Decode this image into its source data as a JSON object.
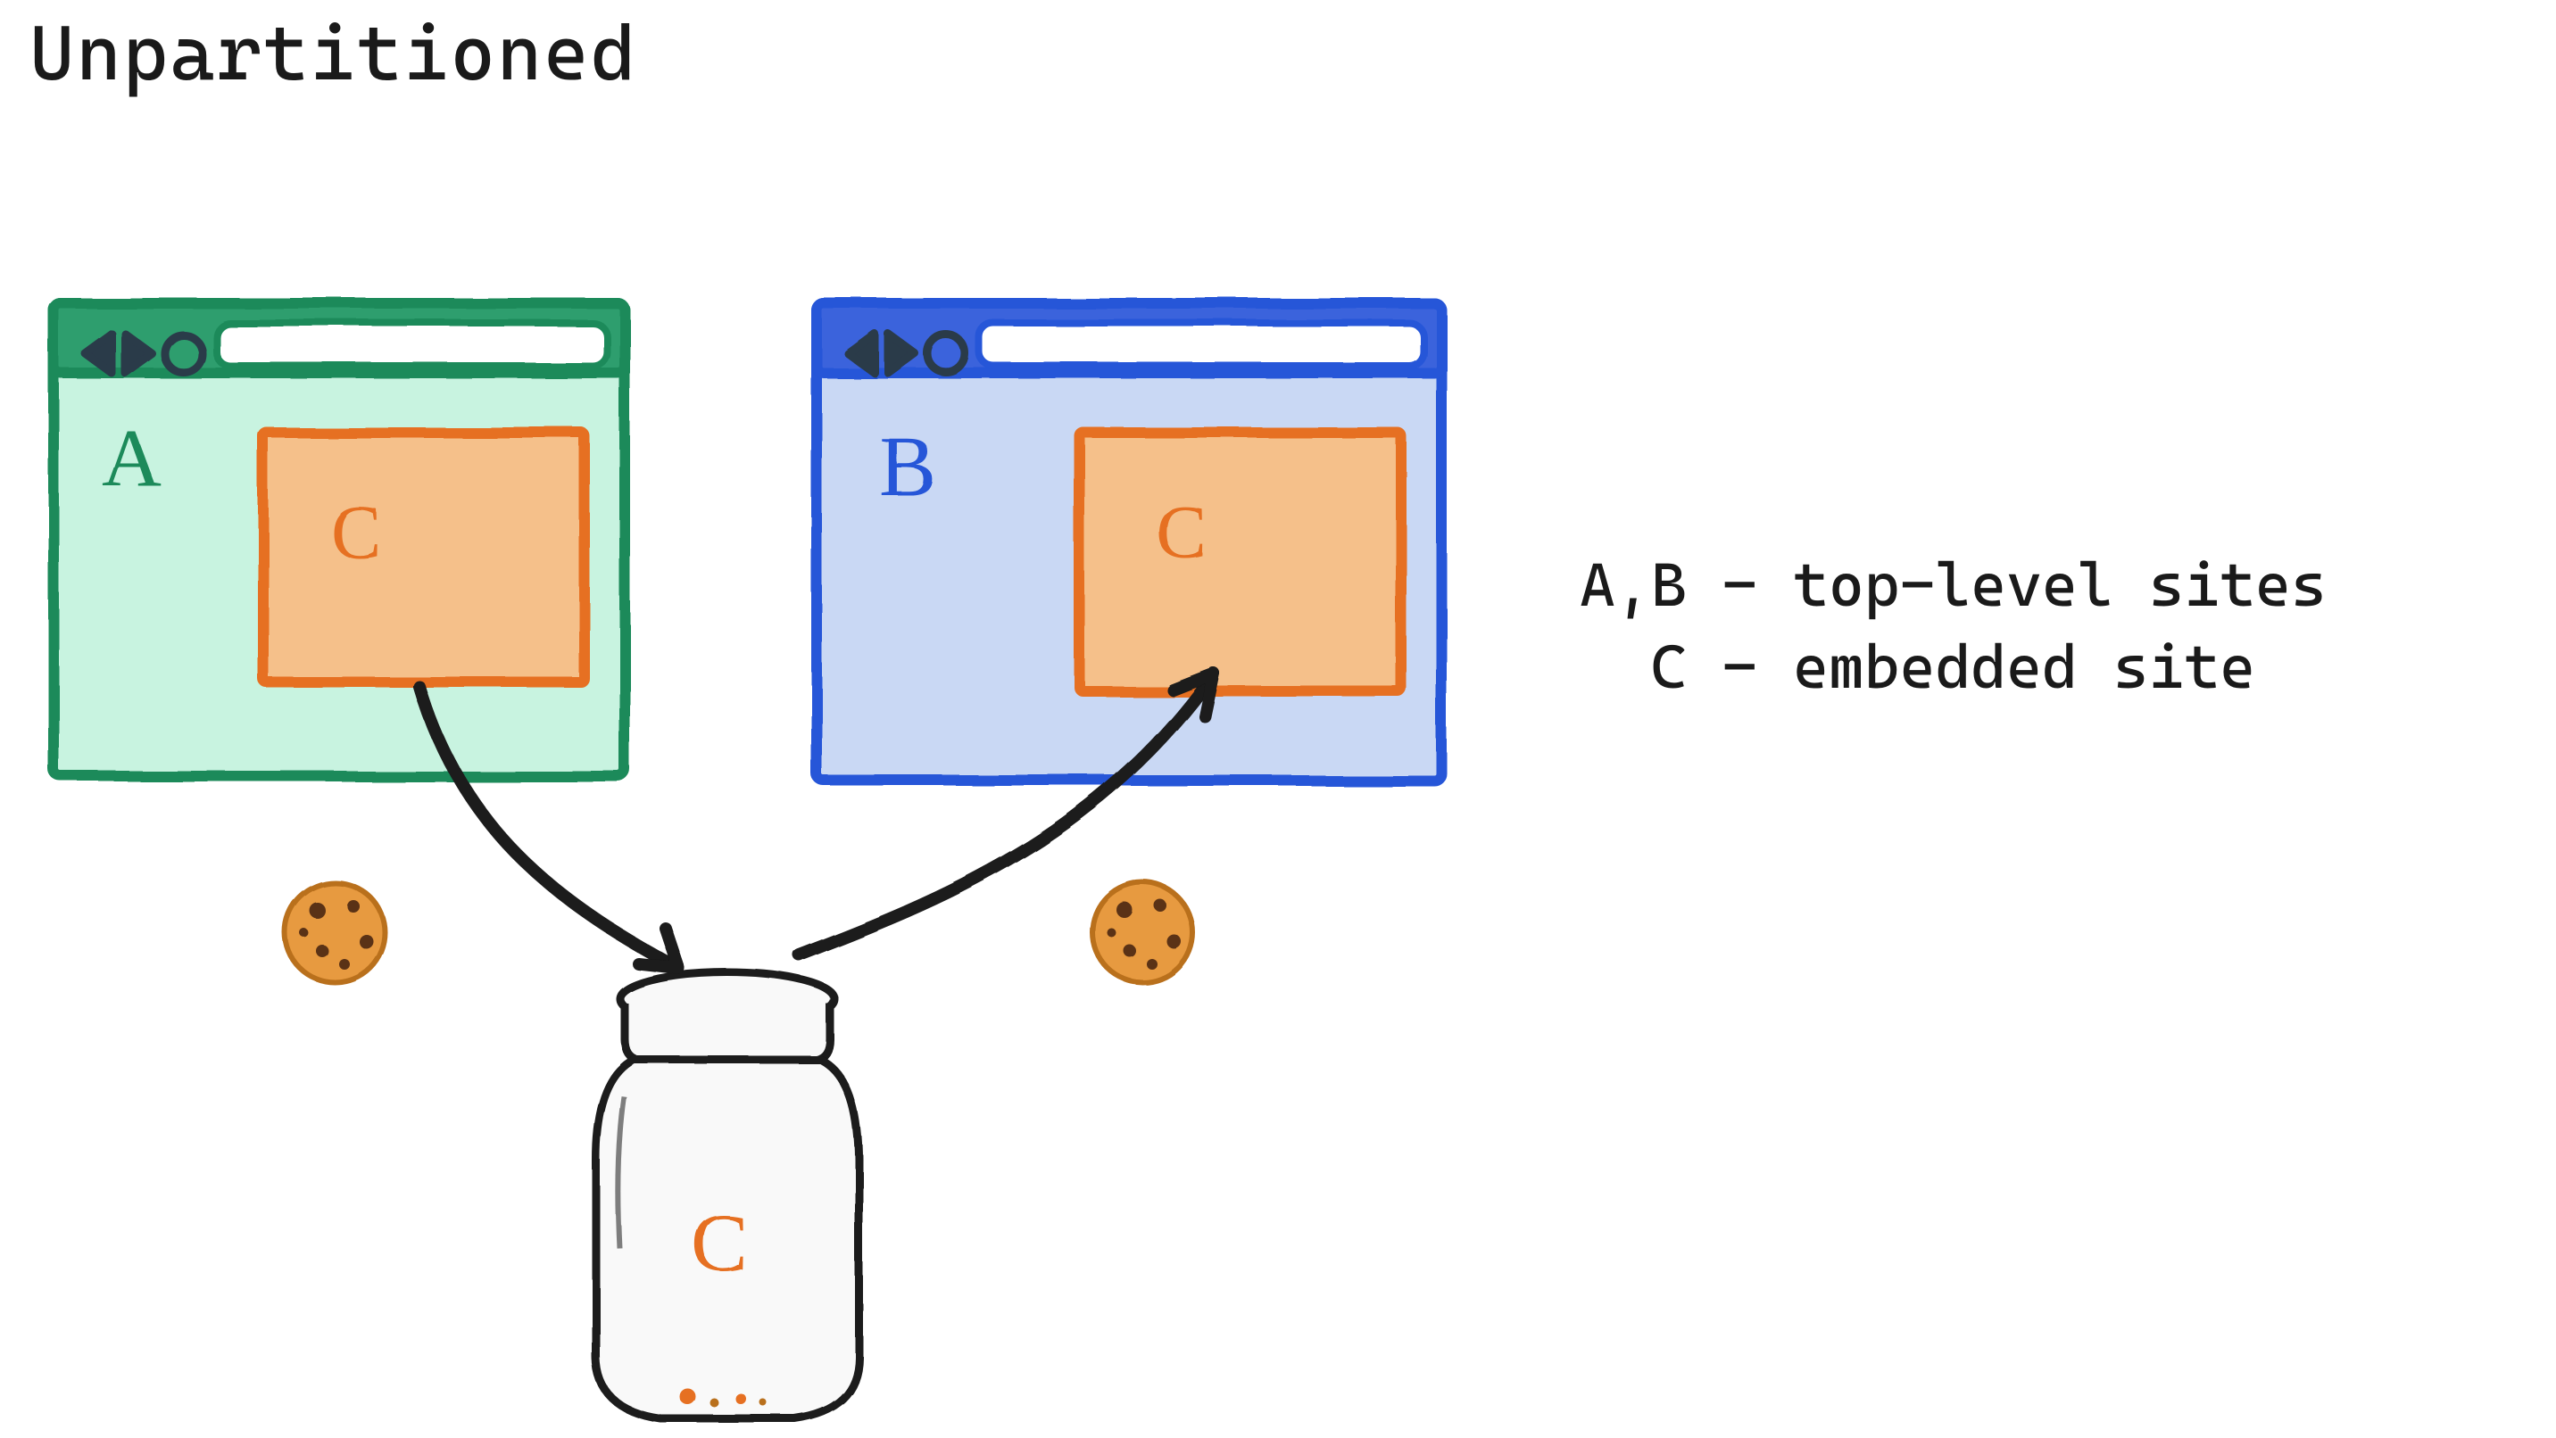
{
  "title": "Unpartitioned",
  "legend": {
    "line1": "A,B - top-level sites",
    "line2": "  C - embedded site"
  },
  "browsers": {
    "a": {
      "label": "A",
      "embed_label": "C"
    },
    "b": {
      "label": "B",
      "embed_label": "C"
    }
  },
  "jar": {
    "label": "C"
  },
  "colors": {
    "a_stroke": "#1b8a5a",
    "a_fill": "#c8f3e0",
    "a_header": "#2e9e6e",
    "b_stroke": "#2556d8",
    "b_fill": "#c9d8f4",
    "b_header": "#3a63dc",
    "embed_stroke": "#e67020",
    "embed_fill": "#f5c08a",
    "ink": "#1a1a1a",
    "nav_ctrl": "#2b3a4a",
    "cookie_fill": "#e79a3f",
    "cookie_edge": "#b96f1d",
    "chip": "#5a3013"
  }
}
